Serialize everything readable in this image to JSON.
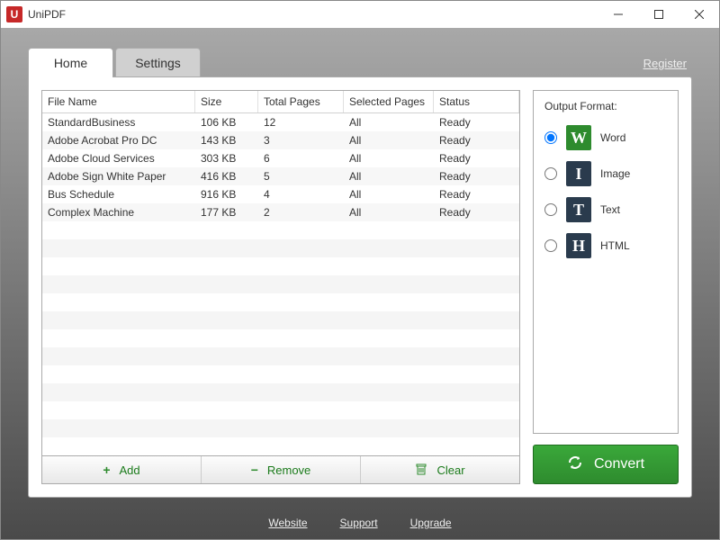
{
  "window": {
    "title": "UniPDF",
    "app_icon_letter": "U"
  },
  "tabs": {
    "home": "Home",
    "settings": "Settings"
  },
  "register_link": "Register",
  "table": {
    "headers": {
      "name": "File Name",
      "size": "Size",
      "total": "Total Pages",
      "selected": "Selected Pages",
      "status": "Status"
    },
    "rows": [
      {
        "name": "StandardBusiness",
        "size": "106 KB",
        "total": "12",
        "selected": "All",
        "status": "Ready"
      },
      {
        "name": "Adobe Acrobat Pro DC",
        "size": "143 KB",
        "total": "3",
        "selected": "All",
        "status": "Ready"
      },
      {
        "name": "Adobe Cloud Services",
        "size": "303 KB",
        "total": "6",
        "selected": "All",
        "status": "Ready"
      },
      {
        "name": "Adobe Sign White Paper",
        "size": "416 KB",
        "total": "5",
        "selected": "All",
        "status": "Ready"
      },
      {
        "name": "Bus Schedule",
        "size": "916 KB",
        "total": "4",
        "selected": "All",
        "status": "Ready"
      },
      {
        "name": "Complex Machine",
        "size": "177 KB",
        "total": "2",
        "selected": "All",
        "status": "Ready"
      }
    ]
  },
  "buttons": {
    "add": "Add",
    "remove": "Remove",
    "clear": "Clear"
  },
  "output": {
    "title": "Output Format:",
    "options": [
      {
        "icon": "W",
        "label": "Word",
        "class": "word",
        "checked": true
      },
      {
        "icon": "I",
        "label": "Image",
        "class": "image",
        "checked": false
      },
      {
        "icon": "T",
        "label": "Text",
        "class": "text",
        "checked": false
      },
      {
        "icon": "H",
        "label": "HTML",
        "class": "html",
        "checked": false
      }
    ]
  },
  "convert": "Convert",
  "footer": {
    "website": "Website",
    "support": "Support",
    "upgrade": "Upgrade"
  }
}
